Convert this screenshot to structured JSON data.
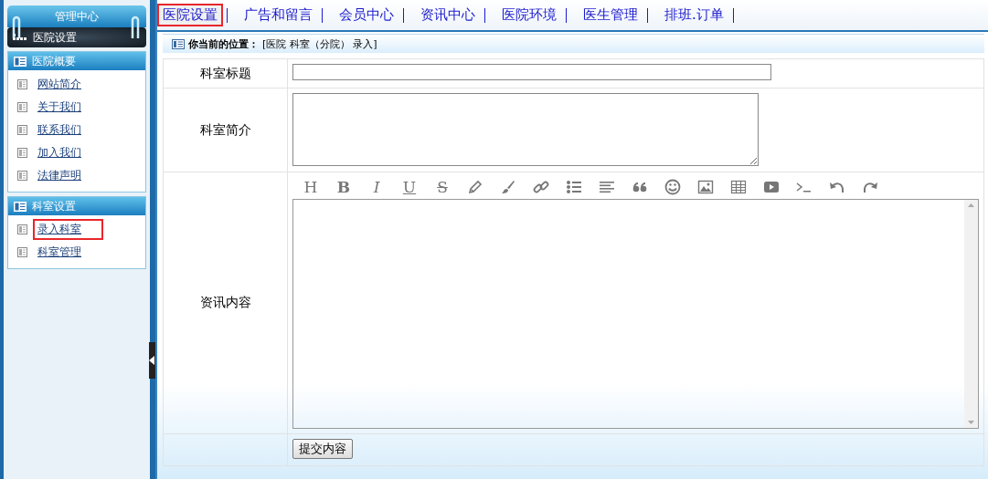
{
  "sidebar": {
    "header": "管理中心",
    "current": "医院设置",
    "sections": [
      {
        "title": "医院概要",
        "links": [
          {
            "label": "网站简介",
            "highlighted": false
          },
          {
            "label": "关于我们",
            "highlighted": false
          },
          {
            "label": "联系我们",
            "highlighted": false
          },
          {
            "label": "加入我们",
            "highlighted": false
          },
          {
            "label": "法律声明",
            "highlighted": false
          }
        ]
      },
      {
        "title": "科室设置",
        "links": [
          {
            "label": "录入科室",
            "highlighted": true
          },
          {
            "label": "科室管理",
            "highlighted": false
          }
        ]
      }
    ]
  },
  "nav": [
    {
      "label": "医院设置",
      "highlighted": true
    },
    {
      "label": "广告和留言",
      "highlighted": false
    },
    {
      "label": "会员中心",
      "highlighted": false
    },
    {
      "label": "资讯中心",
      "highlighted": false
    },
    {
      "label": "医院环境",
      "highlighted": false
    },
    {
      "label": "医生管理",
      "highlighted": false
    },
    {
      "label": "排班.订单",
      "highlighted": false
    }
  ],
  "breadcrumb": {
    "label": "你当前的位置：",
    "path": "[医院 科室（分院） 录入]"
  },
  "form": {
    "title_label": "科室标题",
    "intro_label": "科室简介",
    "content_label": "资讯内容",
    "toolbar": [
      {
        "kind": "heading",
        "text": "H"
      },
      {
        "kind": "bold",
        "text": "B"
      },
      {
        "kind": "italic",
        "text": "I"
      },
      {
        "kind": "underline",
        "text": "U"
      },
      {
        "kind": "strike",
        "text": "S"
      },
      {
        "kind": "pencil"
      },
      {
        "kind": "brush"
      },
      {
        "kind": "link"
      },
      {
        "kind": "list"
      },
      {
        "kind": "align"
      },
      {
        "kind": "quote"
      },
      {
        "kind": "emoji"
      },
      {
        "kind": "image"
      },
      {
        "kind": "table"
      },
      {
        "kind": "video"
      },
      {
        "kind": "code"
      },
      {
        "kind": "undo"
      },
      {
        "kind": "redo"
      }
    ],
    "submit": "提交内容"
  }
}
